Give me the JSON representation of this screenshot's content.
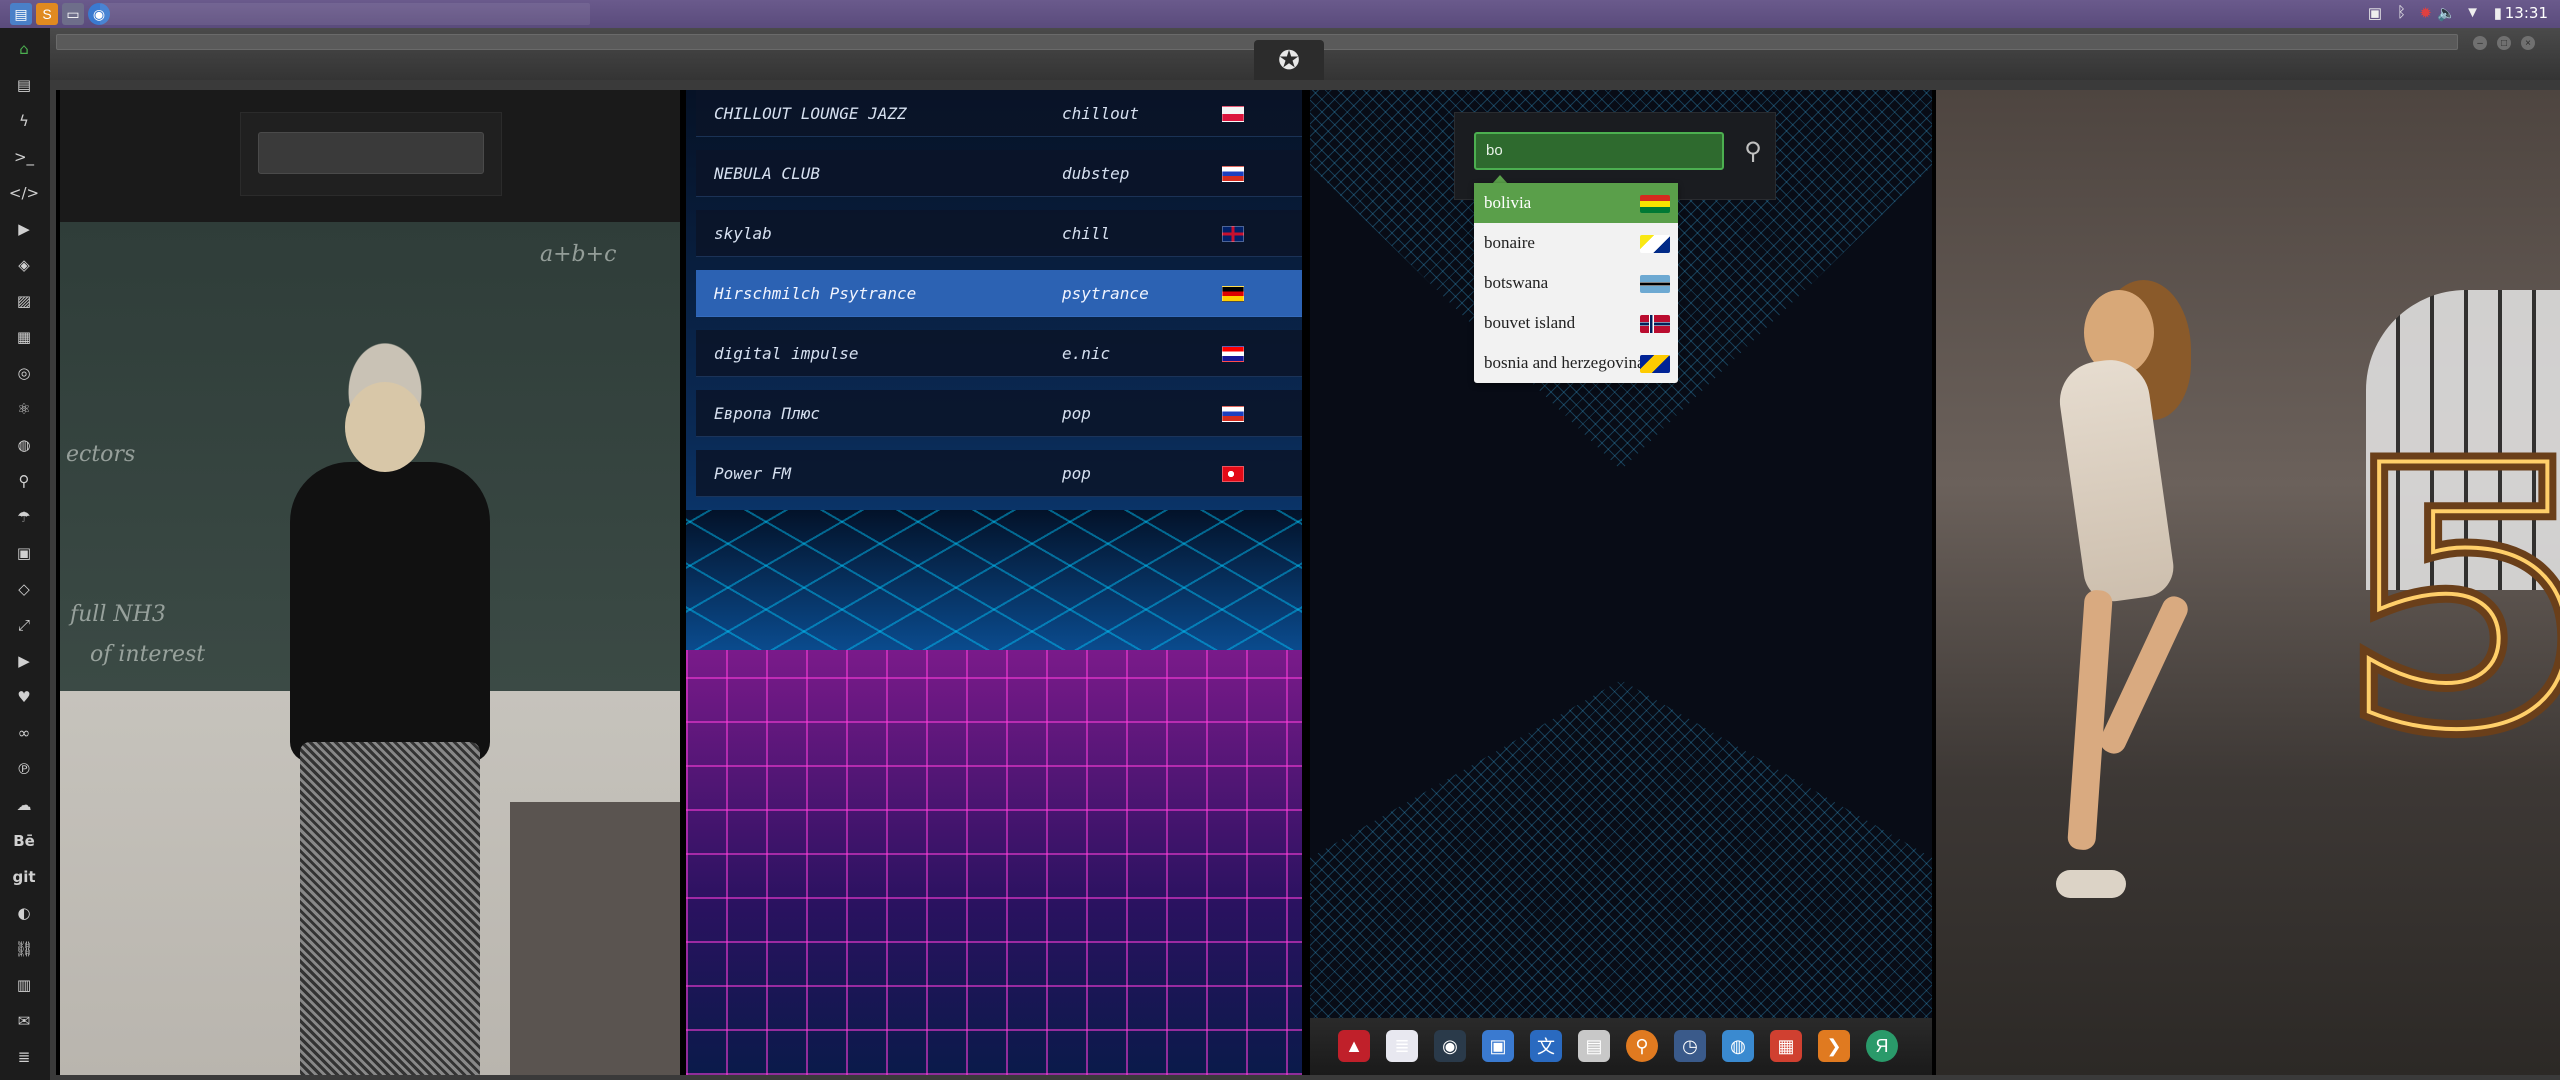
{
  "topbar": {
    "clock": "13:31",
    "tray_icons": [
      "image-icon",
      "bluetooth-icon",
      "settings-icon",
      "volume-icon",
      "wifi-icon",
      "battery-icon"
    ]
  },
  "leftdock": {
    "icons": [
      "home-icon",
      "document-icon",
      "bolt-icon",
      "terminal-icon",
      "code-icon",
      "play-icon",
      "dropbox-icon",
      "image-icon",
      "news-icon",
      "radio-icon",
      "react-icon",
      "globe-icon",
      "search-icon",
      "umbrella-icon",
      "contact-icon",
      "tag-icon",
      "expand-icon",
      "youtube-icon",
      "heart-icon",
      "infinity-icon",
      "pinterest-icon",
      "cloud-icon",
      "behance-icon",
      "git-icon",
      "github-icon",
      "link-icon",
      "map-icon",
      "mail-icon",
      "server-icon"
    ],
    "behance_label": "Bē",
    "git_label": "git"
  },
  "radio": {
    "stations": [
      {
        "name": "CHILLOUT LOUNGE JAZZ",
        "genre": "chillout",
        "flag": "poland"
      },
      {
        "name": "NEBULA CLUB",
        "genre": "dubstep",
        "flag": "russia"
      },
      {
        "name": "skylab",
        "genre": "chill",
        "flag": "uk"
      },
      {
        "name": "Hirschmilch Psytrance",
        "genre": "psytrance",
        "flag": "germany"
      },
      {
        "name": "digital impulse",
        "genre": "e.nic",
        "flag": "croatia"
      },
      {
        "name": "Европа Плюс",
        "genre": "pop",
        "flag": "russia"
      },
      {
        "name": "Power FM",
        "genre": "pop",
        "flag": "turkey"
      }
    ],
    "active_index": 3
  },
  "search": {
    "value": "bo",
    "suggestions": [
      {
        "label": "bolivia",
        "flag": "bolivia"
      },
      {
        "label": "bonaire",
        "flag": "bonaire"
      },
      {
        "label": "botswana",
        "flag": "botswana"
      },
      {
        "label": "bouvet island",
        "flag": "bouvet-island"
      },
      {
        "label": "bosnia and herzegovina",
        "flag": "bosnia"
      }
    ],
    "selected_index": 0
  },
  "chalkboard": {
    "lines": [
      "a+b+c",
      "ectors",
      "full NH3",
      "of interest"
    ]
  },
  "dock_bottom": {
    "apps": [
      "acrobat-icon",
      "text-editor-icon",
      "system-monitor-icon",
      "image-viewer-icon",
      "translate-icon",
      "news-reader-icon",
      "magnifier-icon",
      "clock-icon",
      "browser-icon",
      "calendar-icon",
      "arrow-app-icon",
      "yandex-icon"
    ],
    "yandex_label": "Я"
  },
  "colors": {
    "accent_green": "#5a9f4a",
    "radio_active": "#2c62b3"
  }
}
